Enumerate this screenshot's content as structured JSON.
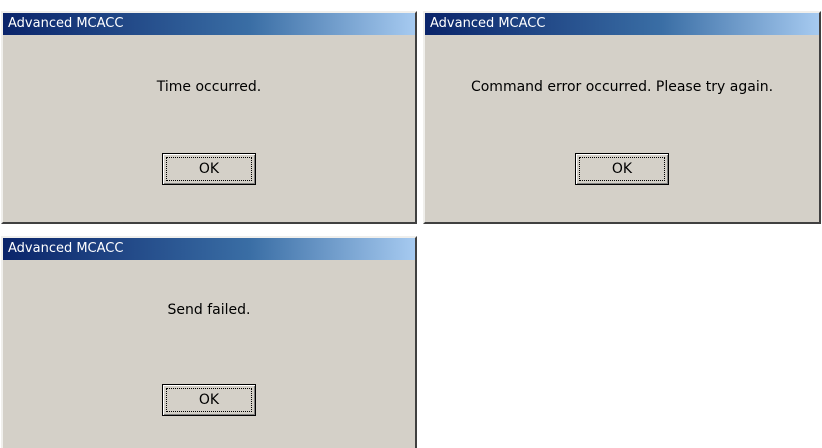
{
  "dialogs": [
    {
      "title": "Advanced MCACC",
      "message": "Time occurred.",
      "ok_label": "OK"
    },
    {
      "title": "Advanced MCACC",
      "message": "Command error occurred. Please try again.",
      "ok_label": "OK"
    },
    {
      "title": "Advanced MCACC",
      "message": "Send failed.",
      "ok_label": "OK"
    }
  ],
  "colors": {
    "titlebar_start": "#0a246a",
    "titlebar_end": "#a6caf0",
    "dialog_face": "#d4d0c8"
  }
}
